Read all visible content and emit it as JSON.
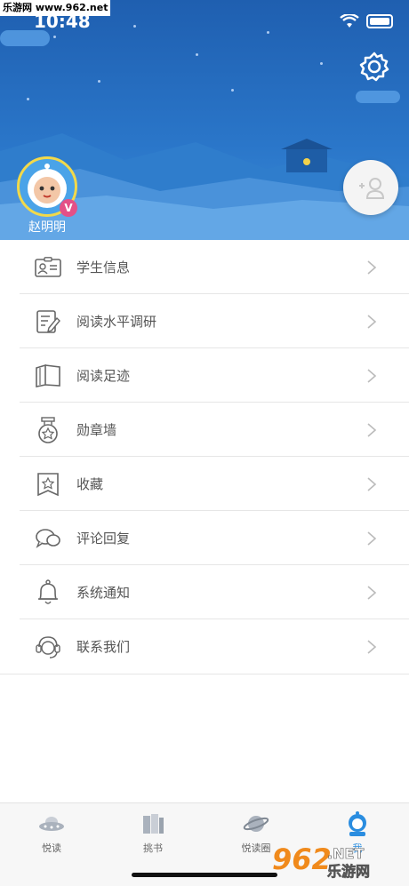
{
  "watermark_top": "乐游网 www.962.net",
  "status": {
    "time": "10:48"
  },
  "profile": {
    "name": "赵明明",
    "badge": "V"
  },
  "menu": [
    {
      "label": "学生信息",
      "icon": "id-card-icon"
    },
    {
      "label": "阅读水平调研",
      "icon": "edit-document-icon"
    },
    {
      "label": "阅读足迹",
      "icon": "open-book-icon"
    },
    {
      "label": "勋章墙",
      "icon": "medal-icon"
    },
    {
      "label": "收藏",
      "icon": "star-bookmark-icon"
    },
    {
      "label": "评论回复",
      "icon": "chat-bubbles-icon"
    },
    {
      "label": "系统通知",
      "icon": "bell-icon"
    },
    {
      "label": "联系我们",
      "icon": "headset-icon"
    }
  ],
  "tabs": [
    {
      "label": "悦读",
      "icon": "ufo-icon"
    },
    {
      "label": "挑书",
      "icon": "books-icon"
    },
    {
      "label": "悦读圈",
      "icon": "planet-icon"
    },
    {
      "label": "我",
      "icon": "astronaut-icon"
    }
  ],
  "watermark_bottom": {
    "number": "962",
    "suffix": ".NET",
    "brand": "乐游网"
  },
  "colors": {
    "header_blue": "#2a76c9",
    "accent": "#1f5fb0",
    "vip": "#e45087"
  }
}
